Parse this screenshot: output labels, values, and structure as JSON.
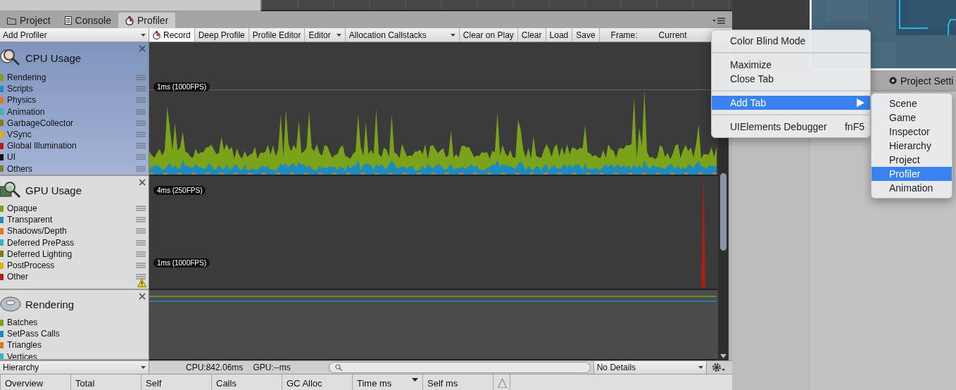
{
  "tabs": [
    {
      "label": "Project",
      "kind": "folder",
      "selected": false
    },
    {
      "label": "Console",
      "kind": "console",
      "selected": false
    },
    {
      "label": "Profiler",
      "kind": "profiler",
      "selected": true
    }
  ],
  "toolbar": {
    "add_profiler": "Add Profiler",
    "buttons": [
      {
        "label": "Record",
        "kind": "record",
        "on": true
      },
      {
        "label": "Deep Profile",
        "kind": "button",
        "on": false
      },
      {
        "label": "Profile Editor",
        "kind": "button",
        "on": false
      },
      {
        "label": "Editor",
        "kind": "dropdown",
        "on": false
      },
      {
        "label": "Allocation Callstacks",
        "kind": "dropdown",
        "on": false
      },
      {
        "label": "Clear on Play",
        "kind": "button",
        "on": false
      },
      {
        "label": "Clear",
        "kind": "button",
        "on": false
      },
      {
        "label": "Load",
        "kind": "button",
        "on": false
      },
      {
        "label": "Save",
        "kind": "button",
        "on": false
      }
    ],
    "frame_label": "Frame:",
    "frame_value": "Current"
  },
  "modules": [
    {
      "title": "CPU Usage",
      "kind": "cpu",
      "selected": true,
      "warning": false,
      "graph_labels": [
        "1ms (1000FPS)"
      ],
      "items": [
        {
          "label": "Rendering",
          "color": "#7ba31a"
        },
        {
          "label": "Scripts",
          "color": "#1e8bbf"
        },
        {
          "label": "Physics",
          "color": "#e07a16"
        },
        {
          "label": "Animation",
          "color": "#33b5c7"
        },
        {
          "label": "GarbageCollector",
          "color": "#857a13"
        },
        {
          "label": "VSync",
          "color": "#e0b013"
        },
        {
          "label": "Global Illumination",
          "color": "#b01d12"
        },
        {
          "label": "UI",
          "color": "#111111"
        },
        {
          "label": "Others",
          "color": "#7a7a2a"
        }
      ]
    },
    {
      "title": "GPU Usage",
      "kind": "gpu",
      "selected": false,
      "warning": true,
      "graph_labels": [
        "4ms (250FPS)",
        "1ms (1000FPS)"
      ],
      "items": [
        {
          "label": "Opaque",
          "color": "#7ba31a"
        },
        {
          "label": "Transparent",
          "color": "#1e8bbf"
        },
        {
          "label": "Shadows/Depth",
          "color": "#e07a16"
        },
        {
          "label": "Deferred PrePass",
          "color": "#33b5c7"
        },
        {
          "label": "Deferred Lighting",
          "color": "#857a13"
        },
        {
          "label": "PostProcess",
          "color": "#e0b013"
        },
        {
          "label": "Other",
          "color": "#b01d12"
        }
      ]
    },
    {
      "title": "Rendering",
      "kind": "rendering",
      "selected": false,
      "warning": false,
      "items": [
        {
          "label": "Batches",
          "color": "#7ba31a"
        },
        {
          "label": "SetPass Calls",
          "color": "#1e8bbf"
        },
        {
          "label": "Triangles",
          "color": "#e07a16"
        },
        {
          "label": "Vertices",
          "color": "#33b5c7"
        }
      ]
    }
  ],
  "bottom_bar": {
    "view": "Hierarchy",
    "cpu": "CPU:842.06ms",
    "gpu": "GPU:--ms",
    "details": "No Details"
  },
  "columns": [
    {
      "label": "Overview",
      "sorted": false
    },
    {
      "label": "Total",
      "sorted": false
    },
    {
      "label": "Self",
      "sorted": false
    },
    {
      "label": "Calls",
      "sorted": false
    },
    {
      "label": "GC Alloc",
      "sorted": false
    },
    {
      "label": "Time ms",
      "sorted": true
    },
    {
      "label": "Self ms",
      "sorted": false
    }
  ],
  "right_panel": {
    "tab": "Project Setti"
  },
  "context_menu": {
    "items": [
      {
        "kind": "item",
        "label": "Color Blind Mode",
        "selected": false
      },
      {
        "kind": "separator"
      },
      {
        "kind": "item",
        "label": "Maximize",
        "selected": false
      },
      {
        "kind": "item",
        "label": "Close Tab",
        "selected": false
      },
      {
        "kind": "separator"
      },
      {
        "kind": "submenu",
        "label": "Add Tab",
        "selected": true
      },
      {
        "kind": "separator"
      },
      {
        "kind": "item",
        "label": "UIElements Debugger",
        "shortcut": "fnF5",
        "selected": false
      }
    ],
    "submenu": [
      {
        "label": "Scene",
        "selected": false
      },
      {
        "label": "Game",
        "selected": false
      },
      {
        "label": "Inspector",
        "selected": false
      },
      {
        "label": "Hierarchy",
        "selected": false
      },
      {
        "label": "Project",
        "selected": false
      },
      {
        "label": "Profiler",
        "selected": true
      },
      {
        "label": "Animation",
        "selected": false
      }
    ]
  }
}
